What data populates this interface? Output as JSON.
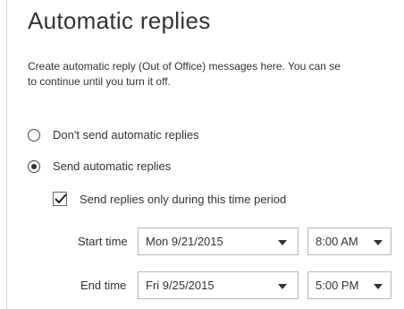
{
  "title": "Automatic replies",
  "description_line1": "Create automatic reply (Out of Office) messages here. You can se",
  "description_line2": "to continue until you turn it off.",
  "options": {
    "dont_send": {
      "label": "Don't send automatic replies",
      "checked": false
    },
    "send": {
      "label": "Send automatic replies",
      "checked": true
    }
  },
  "time_period": {
    "label": "Send replies only during this time period",
    "checked": true
  },
  "start": {
    "label": "Start time",
    "date": "Mon 9/21/2015",
    "time": "8:00 AM"
  },
  "end": {
    "label": "End time",
    "date": "Fri 9/25/2015",
    "time": "5:00 PM"
  }
}
